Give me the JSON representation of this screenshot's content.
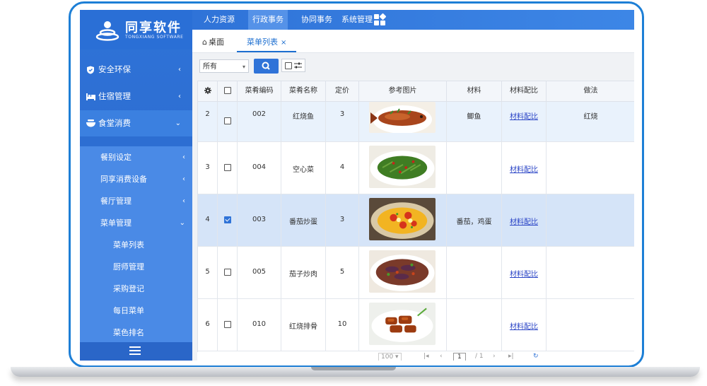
{
  "brand": {
    "title": "同享软件",
    "subtitle": "TONGXIANG SOFTWARE"
  },
  "top_menu": [
    {
      "label": "人力资源"
    },
    {
      "label": "行政事务"
    },
    {
      "label": "协同事务"
    },
    {
      "label": "系统管理"
    }
  ],
  "sidebar": {
    "items": [
      {
        "label": "安全环保",
        "icon": "shield-icon"
      },
      {
        "label": "住宿管理",
        "icon": "bed-icon"
      },
      {
        "label": "食堂消费",
        "icon": "bowl-icon"
      }
    ],
    "sub_items": [
      {
        "label": "餐别设定"
      },
      {
        "label": "同享消费设备"
      },
      {
        "label": "餐厅管理"
      },
      {
        "label": "菜单管理"
      }
    ],
    "leaf_items": [
      {
        "label": "菜单列表"
      },
      {
        "label": "厨师管理"
      },
      {
        "label": "采购登记"
      },
      {
        "label": "每日菜单"
      },
      {
        "label": "菜色排名"
      }
    ]
  },
  "tabs": {
    "home": "桌面",
    "current": "菜单列表",
    "close": "×"
  },
  "toolbar": {
    "filter_value": "所有"
  },
  "table": {
    "headers": [
      "菜肴编码",
      "菜肴名称",
      "定价",
      "参考图片",
      "材料",
      "材料配比",
      "做法"
    ],
    "rows": [
      {
        "index": "2",
        "checked": false,
        "code": "002",
        "name": "红烧鱼",
        "price": "3",
        "image": "braised-fish",
        "material": "鲫鱼",
        "ratio": "材料配比",
        "method": "红烧"
      },
      {
        "index": "3",
        "checked": false,
        "code": "004",
        "name": "空心菜",
        "price": "4",
        "image": "water-spinach",
        "material": "",
        "ratio": "材料配比",
        "method": ""
      },
      {
        "index": "4",
        "checked": true,
        "code": "003",
        "name": "番茄炒蛋",
        "price": "3",
        "image": "tomato-egg",
        "material": "番茄，鸡蛋",
        "ratio": "材料配比",
        "method": ""
      },
      {
        "index": "5",
        "checked": false,
        "code": "005",
        "name": "茄子炒肉",
        "price": "5",
        "image": "eggplant-pork",
        "material": "",
        "ratio": "材料配比",
        "method": ""
      },
      {
        "index": "6",
        "checked": false,
        "code": "010",
        "name": "红烧排骨",
        "price": "10",
        "image": "braised-ribs",
        "material": "",
        "ratio": "材料配比",
        "method": ""
      }
    ]
  },
  "pager": {
    "page_size": "100",
    "page": "1",
    "total": "/ 1"
  },
  "colors": {
    "accent": "#2f73d8",
    "selected_row": "#d5e4f8"
  }
}
